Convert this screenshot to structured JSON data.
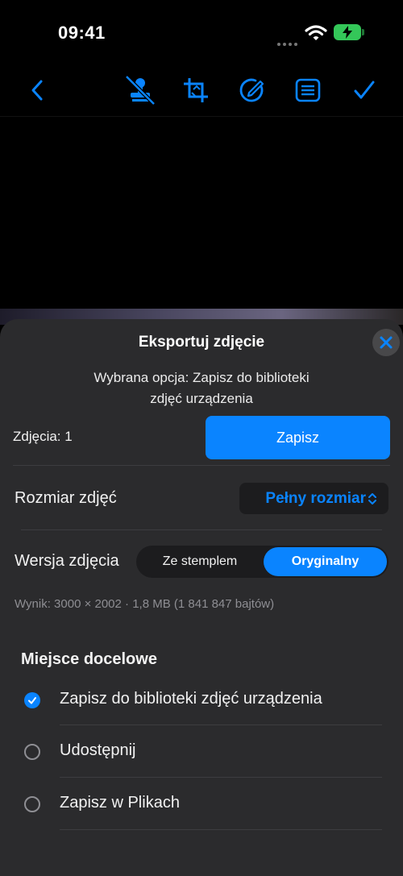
{
  "status_bar": {
    "time": "09:41"
  },
  "toolbar": {
    "icons": [
      "chevron-left-icon",
      "stamp-off-icon",
      "crop-icon",
      "edit-circle-icon",
      "list-icon",
      "checkmark-icon"
    ],
    "accent": "#0a84ff"
  },
  "sheet": {
    "title": "Eksportuj zdjęcie",
    "subtitle_line1": "Wybrana opcja: Zapisz do biblioteki",
    "subtitle_line2": "zdjęć urządzenia",
    "photos_count_label": "Zdjęcia: 1",
    "save_label": "Zapisz",
    "size_label": "Rozmiar zdjęć",
    "size_value": "Pełny rozmiar",
    "version_label": "Wersja zdjęcia",
    "version_options": [
      "Ze stemplem",
      "Oryginalny"
    ],
    "version_selected": "Oryginalny",
    "result_text": "Wynik: 3000 × 2002 · 1,8 MB (1 841 847 bajtów)",
    "destination_header": "Miejsce docelowe",
    "destinations": [
      {
        "label": "Zapisz do biblioteki zdjęć urządzenia",
        "selected": true
      },
      {
        "label": "Udostępnij",
        "selected": false
      },
      {
        "label": "Zapisz w Plikach",
        "selected": false
      }
    ]
  }
}
